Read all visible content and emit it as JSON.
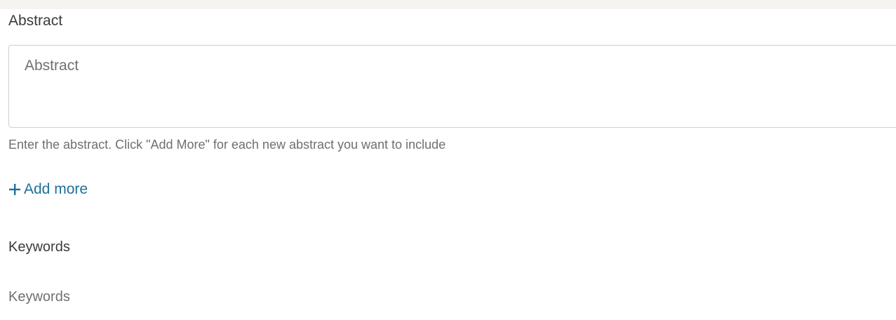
{
  "abstract": {
    "label": "Abstract",
    "placeholder": "Abstract",
    "help_text": "Enter the abstract. Click \"Add More\" for each new abstract you want to include",
    "add_more_label": "Add more"
  },
  "keywords": {
    "label": "Keywords",
    "placeholder": "Keywords"
  },
  "colors": {
    "page_background": "#f5f4f0",
    "panel_background": "#ffffff",
    "link": "#1f6f9a",
    "help_text": "#6f6f6f",
    "border": "#cfcfcf"
  },
  "icons": {
    "add_more": "plus-icon"
  }
}
